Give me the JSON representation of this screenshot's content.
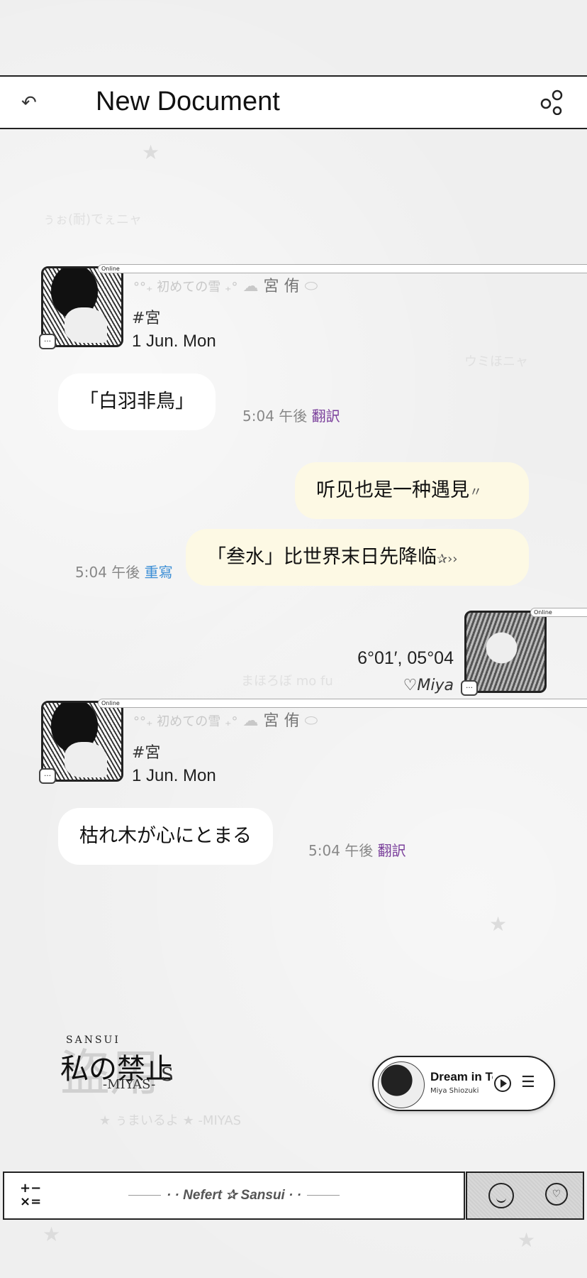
{
  "header": {
    "title": "New Document"
  },
  "background_text": {
    "line1": "ぅぉ(耐)でぇニャ",
    "line2": "ウミほニャ",
    "line3": "まほろぼ mo fu"
  },
  "profile": {
    "online": "Online",
    "soft_name": "°°₊ 初めての雪 ₊°",
    "name": "宮 侑",
    "tag": "#宮",
    "date": "1 Jun. Mon"
  },
  "messages": [
    {
      "text": "「白羽非鳥」",
      "time": "5:04 午後",
      "action": "翻訳"
    },
    {
      "text": "听见也是一种遇見",
      "suffix": "〃"
    },
    {
      "text": "「叁水」比世界末日先降临",
      "suffix": "✰››",
      "time": "5:04 午後",
      "action": "重寫"
    },
    {
      "text": "枯れ木が心にとまる",
      "time": "5:04 午後",
      "action": "翻訳"
    }
  ],
  "self_profile": {
    "online": "Online",
    "coords": "6°01′, 05°04",
    "name": "♡Miya"
  },
  "logo": {
    "top": "SANSUI",
    "main": "私の禁止",
    "sub": "-MIYAS-",
    "s": "S",
    "bg": "盗用",
    "faint": "★  ぅまいるよ  ★  -MIYAS"
  },
  "music": {
    "song": "Dream in Tokyo",
    "artist": "Miya Shiozuki"
  },
  "bottom_bar": {
    "calc_top": "+−",
    "calc_bottom": "×=",
    "signature": "· · Nefert ✰ Sansui · ·"
  }
}
